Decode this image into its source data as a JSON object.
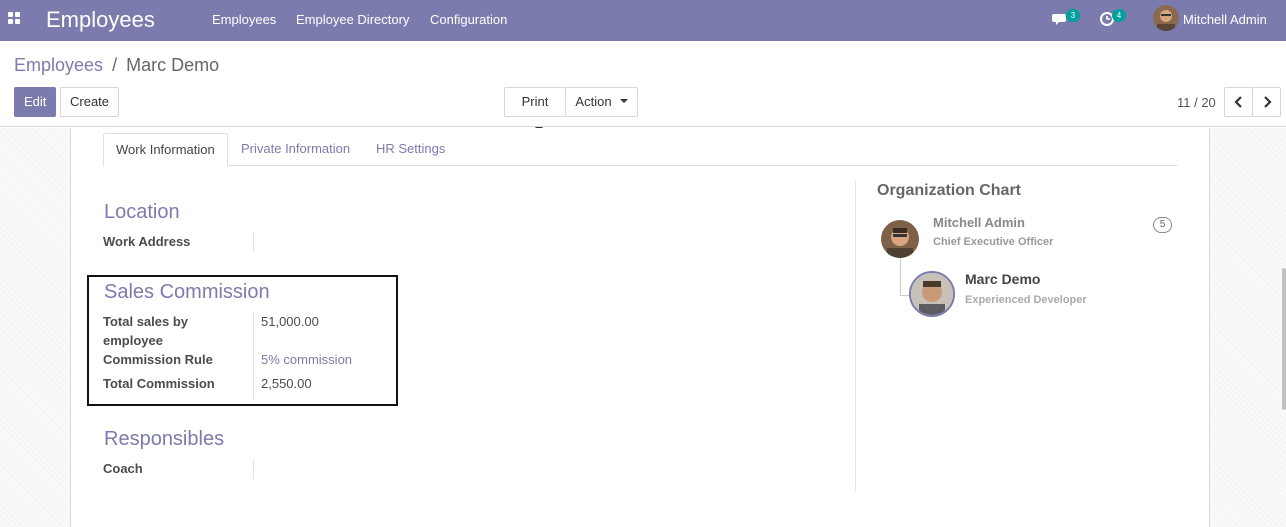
{
  "navbar": {
    "app_title": "Employees",
    "menu": [
      "Employees",
      "Employee Directory",
      "Configuration"
    ],
    "messages_badge": "3",
    "activities_badge": "4",
    "user_name": "Mitchell Admin"
  },
  "breadcrumb": {
    "parent": "Employees",
    "separator": "/",
    "current": "Marc Demo"
  },
  "toolbar": {
    "edit_label": "Edit",
    "create_label": "Create",
    "print_label": "Print",
    "action_label": "Action"
  },
  "pager": {
    "value": "11 / 20"
  },
  "tabs": [
    "Work Information",
    "Private Information",
    "HR Settings"
  ],
  "location": {
    "title": "Location",
    "work_address_label": "Work Address",
    "work_address_value": ""
  },
  "sales_commission": {
    "title": "Sales Commission",
    "total_sales_label": "Total sales by employee",
    "total_sales_value": "51,000.00",
    "commission_rule_label": "Commission Rule",
    "commission_rule_value": "5% commission",
    "total_commission_label": "Total Commission",
    "total_commission_value": "2,550.00"
  },
  "responsibles": {
    "title": "Responsibles",
    "coach_label": "Coach",
    "coach_value": ""
  },
  "org_chart": {
    "title": "Organization Chart",
    "manager_name": "Mitchell Admin",
    "manager_job": "Chief Executive Officer",
    "manager_count": "5",
    "employee_name": "Marc Demo",
    "employee_job": "Experienced Developer"
  },
  "colors": {
    "brand": "#7c7bad",
    "badge": "#00a09d"
  }
}
